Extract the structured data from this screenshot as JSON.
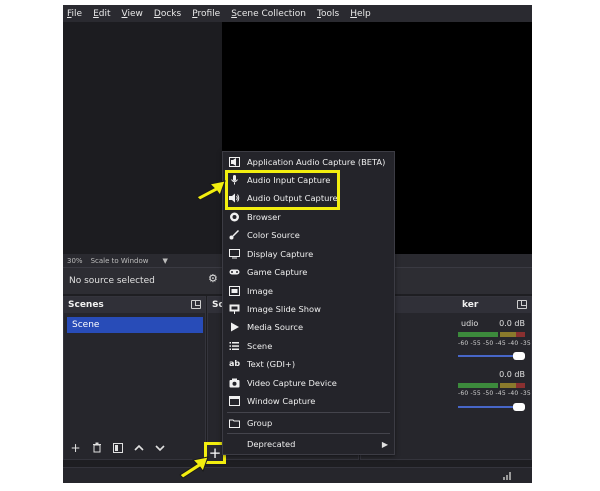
{
  "menubar": [
    "File",
    "Edit",
    "View",
    "Docks",
    "Profile",
    "Scene Collection",
    "Tools",
    "Help"
  ],
  "zoom": {
    "percent": "30%",
    "mode": "Scale to Window"
  },
  "context_bar": {
    "no_source": "No source selected"
  },
  "scenes_dock": {
    "title": "Scenes",
    "items": [
      "Scene"
    ]
  },
  "sources_dock": {
    "title_visible": "So"
  },
  "mixer_dock": {
    "title_visible": "ker",
    "channel1": {
      "name_visible": "udio",
      "db": "0.0 dB"
    },
    "channel2": {
      "db": "0.0 dB"
    },
    "scale": "-60 -55 -50 -45 -40 -35 -30 -25 -20 -15 -10 -5  0"
  },
  "add_button": "+",
  "menu": {
    "items": [
      {
        "label": "Application Audio Capture (BETA)",
        "icon": "app-audio-icon"
      },
      {
        "label": "Audio Input Capture",
        "icon": "microphone-icon"
      },
      {
        "label": "Audio Output Capture",
        "icon": "speaker-icon"
      },
      {
        "label": "Browser",
        "icon": "globe-icon"
      },
      {
        "label": "Color Source",
        "icon": "brush-icon"
      },
      {
        "label": "Display Capture",
        "icon": "monitor-icon"
      },
      {
        "label": "Game Capture",
        "icon": "gamepad-icon"
      },
      {
        "label": "Image",
        "icon": "image-icon"
      },
      {
        "label": "Image Slide Show",
        "icon": "slideshow-icon"
      },
      {
        "label": "Media Source",
        "icon": "play-icon"
      },
      {
        "label": "Scene",
        "icon": "list-icon"
      },
      {
        "label": "Text (GDI+)",
        "icon": "text-icon"
      },
      {
        "label": "Video Capture Device",
        "icon": "camera-icon"
      },
      {
        "label": "Window Capture",
        "icon": "window-icon"
      }
    ],
    "group": {
      "label": "Group",
      "icon": "group-icon"
    },
    "deprecated": {
      "label": "Deprecated",
      "icon": "submenu-arrow-icon"
    }
  },
  "colors": {
    "highlight": "#f2ee0f",
    "selection": "#284cb8"
  }
}
